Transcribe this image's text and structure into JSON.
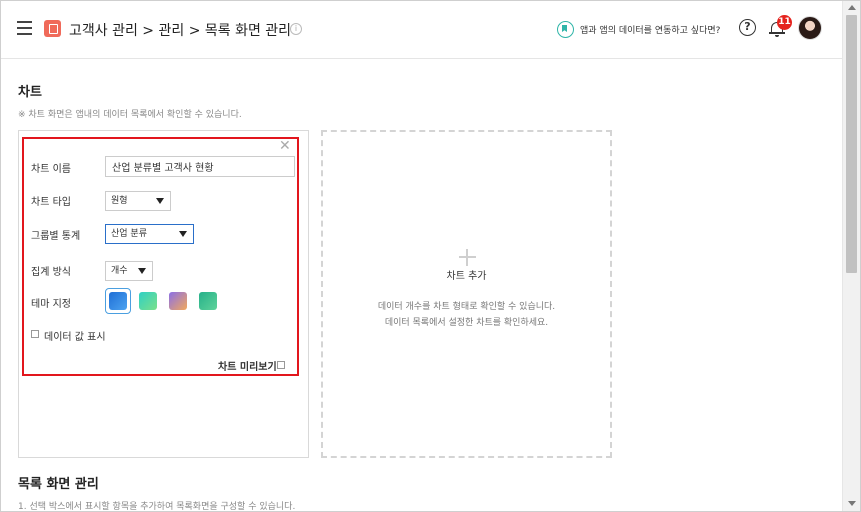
{
  "header": {
    "breadcrumb": "고객사 관리 > 관리 > 목록 화면 관리",
    "info_icon_glyph": "i",
    "link_text": "앱과 앱의 데이터를 연동하고 싶다면?",
    "help_glyph": "?",
    "notification_count": "11"
  },
  "chart_section": {
    "title": "차트",
    "description": "※ 차트 화면은 앱내의 데이터 목록에서 확인할 수 있습니다."
  },
  "chart_form": {
    "close_glyph": "✕",
    "name_label": "차트 이름",
    "name_value": "산업 분류별 고객사 현황",
    "type_label": "차트 타입",
    "type_value": "원형",
    "group_label": "그룹별 통계",
    "group_value": "산업 분류",
    "aggregate_label": "집계 방식",
    "aggregate_value": "개수",
    "theme_label": "테마 지정",
    "themes": [
      {
        "name": "blue",
        "colors": [
          "#1f6fd6",
          "#4da3f0"
        ],
        "selected": true
      },
      {
        "name": "teal-green",
        "colors": [
          "#2fd0c4",
          "#7be08a"
        ],
        "selected": false
      },
      {
        "name": "purple-orange",
        "colors": [
          "#8a6fe8",
          "#f2a85c"
        ],
        "selected": false
      },
      {
        "name": "green",
        "colors": [
          "#26b08a",
          "#5fd39a"
        ],
        "selected": false
      }
    ],
    "show_values_label": "데이터 값 표시",
    "show_values_checked": false,
    "preview_label": "차트 미리보기",
    "preview_checked": false
  },
  "add_chart": {
    "title": "차트 추가",
    "desc_line1": "데이터 개수를 차트 형태로 확인할 수 있습니다.",
    "desc_line2": "데이터 목록에서 설정한 차트를 확인하세요."
  },
  "list_section": {
    "title": "목록 화면 관리",
    "description": "1. 선택 박스에서 표시할 항목을 추가하여 목록화면을 구성할 수 있습니다."
  },
  "colors": {
    "accent_red": "#e2161d",
    "badge_red": "#e5231e",
    "link_teal": "#2fb5a8",
    "focus_blue": "#2a6fc9"
  }
}
